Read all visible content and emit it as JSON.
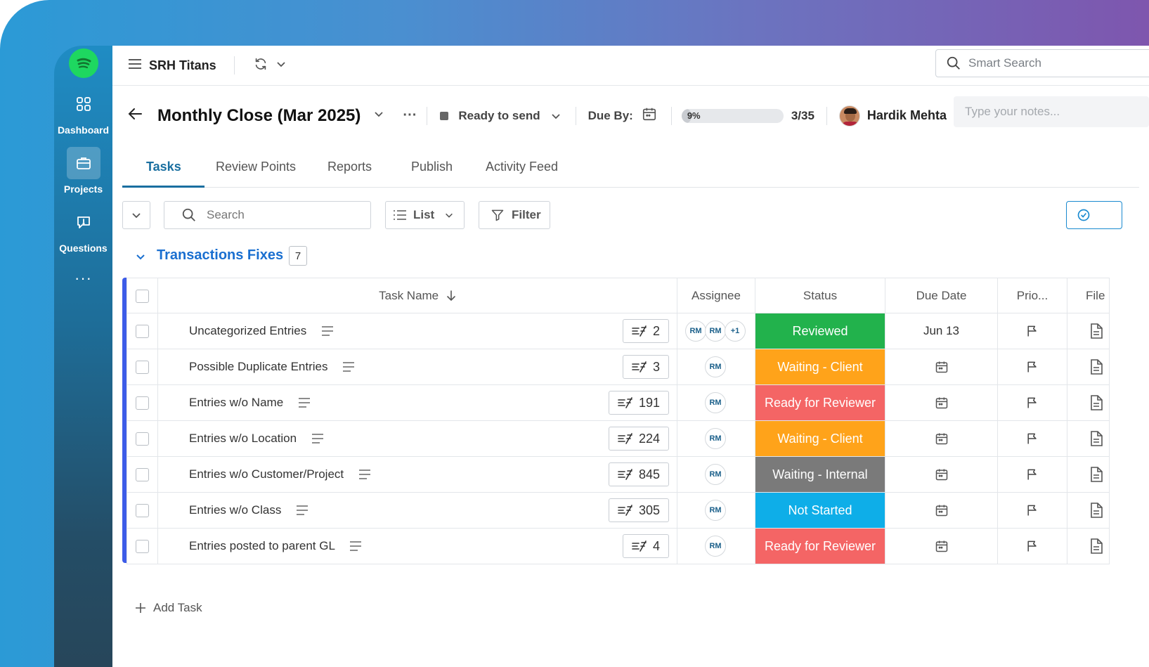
{
  "sidebar": {
    "logo_icon": "spotify-logo",
    "items": [
      {
        "label": "Dashboard",
        "icon": "grid-icon",
        "active": false
      },
      {
        "label": "Projects",
        "icon": "briefcase-icon",
        "active": true
      },
      {
        "label": "Questions",
        "icon": "question-bubble-icon",
        "active": false
      }
    ],
    "more": "···"
  },
  "topbar": {
    "workspace": "SRH Titans",
    "smart_search_placeholder": "Smart Search"
  },
  "header": {
    "title": "Monthly Close (Mar 2025)",
    "status": "Ready to send",
    "due_by_label": "Due By:",
    "progress_percent": 9,
    "progress_label": "9%",
    "task_count": "3/35",
    "user_name": "Hardik Mehta",
    "notes_placeholder": "Type your notes..."
  },
  "tabs": [
    "Tasks",
    "Review Points",
    "Reports",
    "Publish",
    "Activity Feed"
  ],
  "toolbar": {
    "search_placeholder": "Search",
    "view_label": "List",
    "filter_label": "Filter"
  },
  "group": {
    "title": "Transactions Fixes",
    "count": "7"
  },
  "table": {
    "columns": {
      "task_name": "Task Name",
      "assignee": "Assignee",
      "status": "Status",
      "due_date": "Due Date",
      "priority": "Prio...",
      "files": "File"
    },
    "rows": [
      {
        "name": "Uncategorized Entries",
        "subtasks": "2",
        "assignees": [
          "RM",
          "RM",
          "+1"
        ],
        "status": "Reviewed",
        "status_color": "#22b24c",
        "due": "Jun 13"
      },
      {
        "name": "Possible Duplicate Entries",
        "subtasks": "3",
        "assignees": [
          "RM"
        ],
        "status": "Waiting - Client",
        "status_color": "#ffa31a",
        "due": ""
      },
      {
        "name": "Entries w/o Name",
        "subtasks": "191",
        "assignees": [
          "RM"
        ],
        "status": "Ready for Reviewer",
        "status_color": "#f46565",
        "due": ""
      },
      {
        "name": "Entries w/o Location",
        "subtasks": "224",
        "assignees": [
          "RM"
        ],
        "status": "Waiting - Client",
        "status_color": "#ffa31a",
        "due": ""
      },
      {
        "name": "Entries w/o Customer/Project",
        "subtasks": "845",
        "assignees": [
          "RM"
        ],
        "status": "Waiting - Internal",
        "status_color": "#7a7a7a",
        "due": ""
      },
      {
        "name": "Entries w/o Class",
        "subtasks": "305",
        "assignees": [
          "RM"
        ],
        "status": "Not Started",
        "status_color": "#0eaee8",
        "due": ""
      },
      {
        "name": "Entries posted to parent GL",
        "subtasks": "4",
        "assignees": [
          "RM"
        ],
        "status": "Ready for Reviewer",
        "status_color": "#f46565",
        "due": ""
      }
    ]
  },
  "add_task_label": "Add Task",
  "colors": {
    "accent": "#1a6fa0",
    "group_title": "#1a6fd0",
    "group_bar": "#3d5ce8",
    "spotify_green": "#1ed760"
  }
}
